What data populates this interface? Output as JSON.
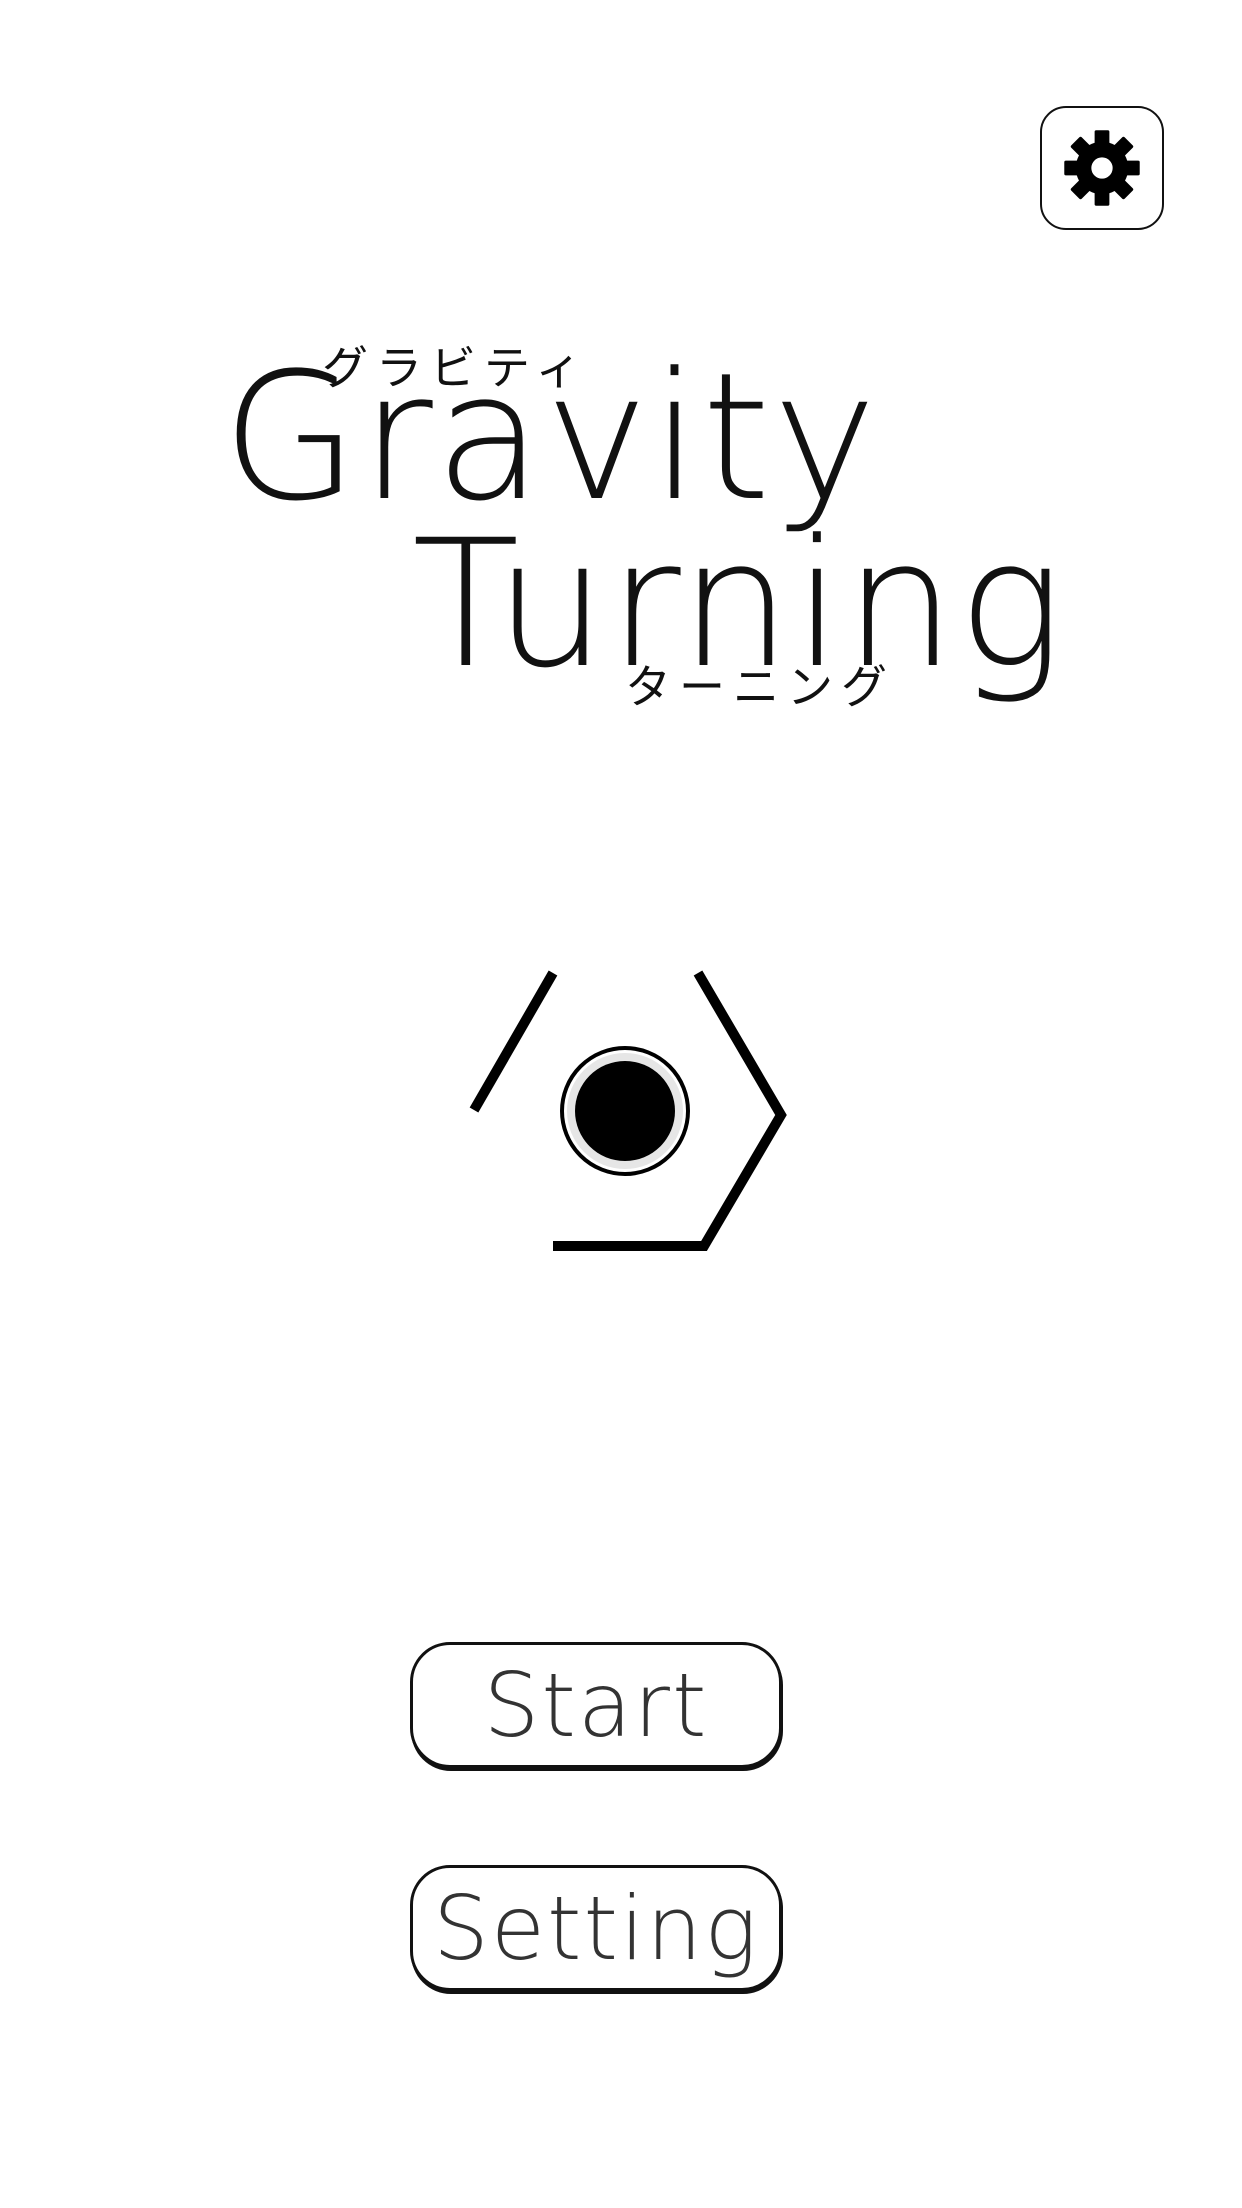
{
  "title": {
    "line1": "Gravity",
    "line2": "Turning",
    "furigana_top": "グラビティ",
    "furigana_bottom": "ターニング"
  },
  "menu": {
    "start_label": "Start",
    "setting_label": "Setting"
  },
  "icons": {
    "settings": "gear-icon"
  },
  "colors": {
    "background": "#ffffff",
    "foreground": "#111111",
    "button_text": "#333333"
  }
}
